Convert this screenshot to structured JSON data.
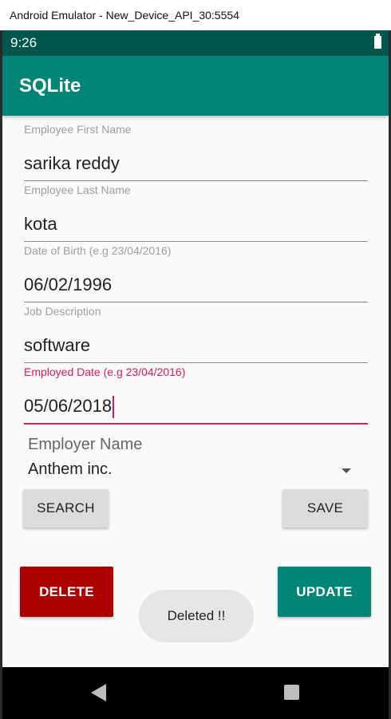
{
  "window": {
    "title": "Android Emulator - New_Device_API_30:5554"
  },
  "status_bar": {
    "time": "9:26"
  },
  "app_bar": {
    "title": "SQLite"
  },
  "form": {
    "first_name": {
      "label": "Employee First Name",
      "value": "sarika reddy"
    },
    "last_name": {
      "label": "Employee Last Name",
      "value": "kota"
    },
    "dob": {
      "label": "Date of Birth (e.g 23/04/2016)",
      "value": "06/02/1996"
    },
    "job": {
      "label": "Job Description",
      "value": "software"
    },
    "employed_date": {
      "label": "Employed Date (e.g 23/04/2016)",
      "value": "05/06/2018"
    },
    "employer": {
      "label": "Employer Name",
      "selected": "Anthem inc."
    }
  },
  "buttons": {
    "search": "SEARCH",
    "save": "SAVE",
    "delete": "DELETE",
    "update": "UPDATE"
  },
  "toast": {
    "message": "Deleted !!"
  },
  "colors": {
    "primary": "#008577",
    "primary_dark": "#00574b",
    "accent": "#d81b60",
    "delete": "#aa0000"
  },
  "icons": {
    "battery": "battery-icon",
    "back": "back-icon",
    "recents": "recents-icon",
    "dropdown": "chevron-down-icon"
  }
}
